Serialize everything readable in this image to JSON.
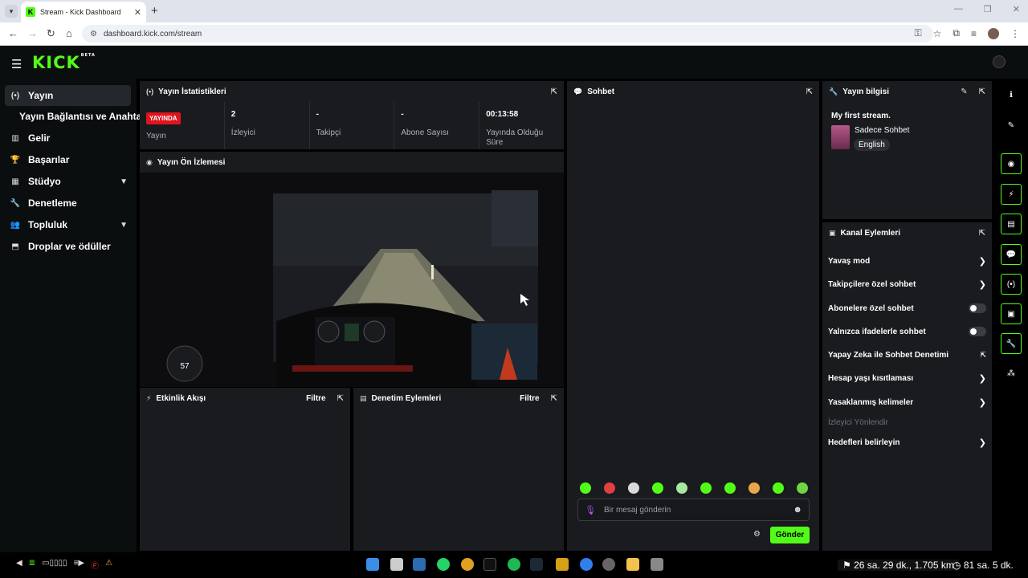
{
  "browser": {
    "tab_title": "Stream - Kick Dashboard",
    "tab_favicon_letter": "K",
    "url": "dashboard.kick.com/stream"
  },
  "header": {
    "logo": "KICK",
    "logo_badge": "BETA"
  },
  "sidebar": {
    "items": [
      {
        "label": "Yayın",
        "icon": "broadcast-icon"
      },
      {
        "label": "Yayın Bağlantısı ve Anahtarı"
      },
      {
        "label": "Gelir",
        "icon": "chart-icon"
      },
      {
        "label": "Başarılar",
        "icon": "trophy-icon"
      },
      {
        "label": "Stüdyo",
        "icon": "studio-icon"
      },
      {
        "label": "Denetleme",
        "icon": "wrench-icon"
      },
      {
        "label": "Topluluk",
        "icon": "people-icon"
      },
      {
        "label": "Droplar ve ödüller",
        "icon": "gift-icon"
      }
    ]
  },
  "stats_panel": {
    "title": "Yayın İstatistikleri",
    "live_badge": "YAYINDA",
    "stats": [
      {
        "value": "",
        "label": "Yayın"
      },
      {
        "value": "2",
        "label": "İzleyici"
      },
      {
        "value": "-",
        "label": "Takipçi"
      },
      {
        "value": "-",
        "label": "Abone Sayısı"
      },
      {
        "value": "00:13:58",
        "label": "Yayında Olduğu Süre"
      }
    ]
  },
  "preview_panel": {
    "title": "Yayın Ön İzlemesi",
    "speed": "57"
  },
  "activity_panel": {
    "title": "Etkinlik Akışı",
    "filter": "Filtre"
  },
  "moderation_panel": {
    "title": "Denetim Eylemleri",
    "filter": "Filtre"
  },
  "chat_panel": {
    "title": "Sohbet",
    "placeholder": "Bir mesaj gönderin",
    "send_label": "Gönder"
  },
  "stream_info": {
    "title": "Yayın bilgisi",
    "stream_title": "My first stream.",
    "category": "Sadece Sohbet",
    "language": "English"
  },
  "channel_actions": {
    "title": "Kanal Eylemleri",
    "rows": [
      {
        "label": "Yavaş mod",
        "control": "chevron"
      },
      {
        "label": "Takipçilere özel sohbet",
        "control": "chevron"
      },
      {
        "label": "Abonelere özel sohbet",
        "control": "toggle"
      },
      {
        "label": "Yalnızca ifadelerle sohbet",
        "control": "toggle"
      },
      {
        "label": "Yapay Zeka ile Sohbet Denetimi",
        "control": "external"
      },
      {
        "label": "Hesap yaşı kısıtlaması",
        "control": "chevron"
      },
      {
        "label": "Yasaklanmış kelimeler",
        "control": "chevron"
      },
      {
        "label": "İzleyici Yönlendir",
        "control": "none"
      },
      {
        "label": "Hedefleri belirleyin",
        "control": "chevron"
      }
    ]
  },
  "taskbar": {
    "eta_text": "26 sa. 29 dk., 1.705 km",
    "time_text": "81 sa. 5 dk."
  },
  "colors": {
    "accent": "#53fc18",
    "live": "#e0141e",
    "panel_bg": "#191b1f",
    "page_bg": "#000000"
  }
}
